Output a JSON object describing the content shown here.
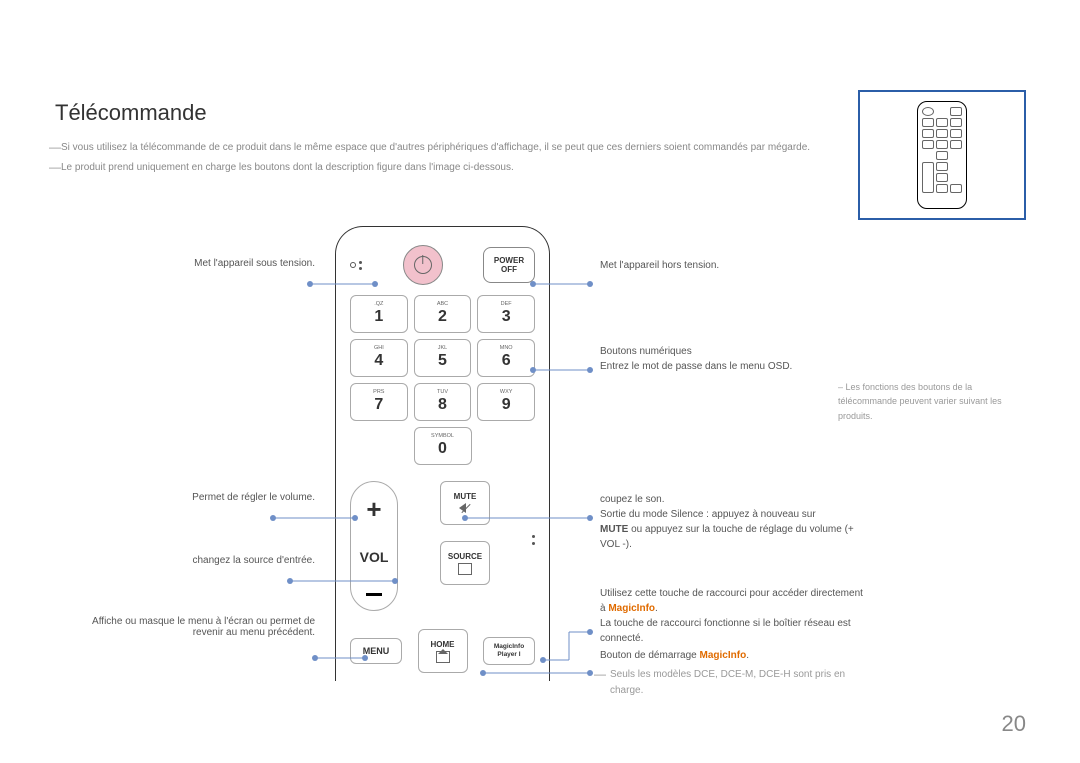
{
  "title": "Télécommande",
  "notes": [
    "Si vous utilisez la télécommande de ce produit dans le même espace que d'autres périphériques d'affichage, il se peut que ces derniers soient commandés par mégarde.",
    "Le produit prend uniquement en charge les boutons dont la description figure dans l'image ci-dessous."
  ],
  "left": {
    "power_on": "Met l'appareil sous tension.",
    "volume": "Permet de régler le volume.",
    "source": "changez la source d'entrée.",
    "menu": "Affiche ou masque le menu à l'écran ou permet de revenir au menu précédent."
  },
  "right": {
    "power_off": "Met l'appareil hors tension.",
    "numeric_title": "Boutons numériques",
    "numeric_desc": "Entrez le mot de passe dans le menu OSD.",
    "mute_title": "coupez le son.",
    "mute_line1": "Sortie du mode Silence : appuyez à nouveau sur",
    "mute_line2_pre": "MUTE",
    "mute_line2_post": " ou appuyez sur la touche de réglage du volume (+ VOL -).",
    "magic_pre": "Utilisez cette touche de raccourci pour accéder directement à ",
    "magic_bold": "MagicInfo",
    "magic_post": ".",
    "magic_desc": "La touche de raccourci fonctionne si le boîtier réseau est connecté.",
    "home_pre": "Bouton de démarrage ",
    "home_bold": "MagicInfo",
    "home_post": ".",
    "home_note": "Seuls les modèles DCE, DCE-M, DCE-H sont pris en charge."
  },
  "remote": {
    "power_off_label1": "POWER",
    "power_off_label2": "OFF",
    "keys": [
      {
        "sub": ".QZ",
        "num": "1"
      },
      {
        "sub": "ABC",
        "num": "2"
      },
      {
        "sub": "DEF",
        "num": "3"
      },
      {
        "sub": "GHI",
        "num": "4"
      },
      {
        "sub": "JKL",
        "num": "5"
      },
      {
        "sub": "MNO",
        "num": "6"
      },
      {
        "sub": "PRS",
        "num": "7"
      },
      {
        "sub": "TUV",
        "num": "8"
      },
      {
        "sub": "WXY",
        "num": "9"
      }
    ],
    "zero_sub": "SYMBOL",
    "zero": "0",
    "vol": "VOL",
    "mute": "MUTE",
    "source": "SOURCE",
    "menu": "MENU",
    "home": "HOME",
    "magic_l1": "MagicInfo",
    "magic_l2": "Player I"
  },
  "side_note": "Les fonctions des boutons de la télécommande peuvent varier suivant les produits.",
  "page_number": "20"
}
